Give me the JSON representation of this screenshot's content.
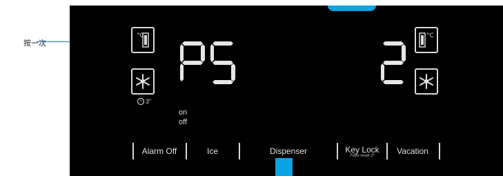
{
  "annotation": {
    "label": "按一次"
  },
  "display": {
    "left_digits": "P5",
    "right_digits": "2",
    "on_label": "on",
    "off_label": "off",
    "timer_label": "3\""
  },
  "buttons": [
    {
      "label": "Alarm Off"
    },
    {
      "label": "Ice"
    },
    {
      "label": "Dispenser"
    },
    {
      "label": "Key Lock",
      "sub": "Filter reset 3\""
    },
    {
      "label": "Vacation"
    }
  ],
  "colors": {
    "panel": "#000000",
    "segment": "#e6e6e6",
    "accent": "#0aa3e6",
    "callout_line": "#1a73e8"
  },
  "icons": [
    "fridge-left-temp-icon",
    "freezer-snowflake-icon",
    "fridge-right-temp-icon",
    "freezer-snowflake-icon",
    "filter-timer-icon"
  ]
}
